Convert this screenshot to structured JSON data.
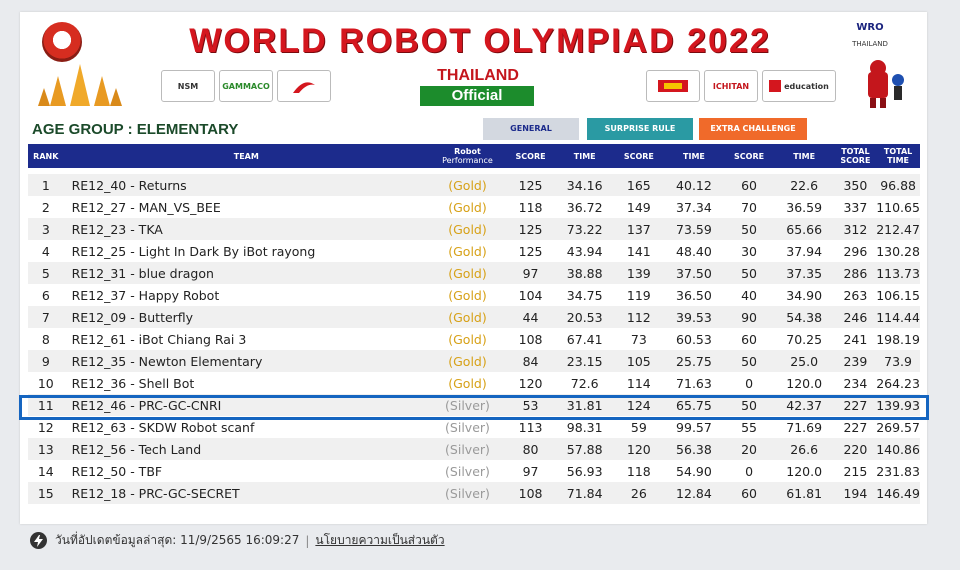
{
  "header": {
    "title": "WORLD ROBOT OLYMPIAD 2022",
    "country": "THAILAND",
    "status": "Official",
    "wro_logo": "WRO",
    "wro_country": "THAILAND",
    "sponsors_left": [
      "NSM",
      "GAMMACO",
      ""
    ],
    "sponsors_right": [
      "",
      "ICHITAN",
      "education"
    ]
  },
  "age_group": "AGE GROUP : ELEMENTARY",
  "tabs": {
    "general": "GENERAL",
    "surprise": "SURPRISE RULE",
    "extra": "EXTRA CHALLENGE"
  },
  "columns": {
    "rank": "RANK",
    "team": "TEAM",
    "perf_top": "Robot",
    "perf_bottom": "Performance",
    "score1": "SCORE",
    "time1": "TIME",
    "score2": "SCORE",
    "time2": "TIME",
    "score3": "SCORE",
    "time3": "TIME",
    "total_score_top": "TOTAL",
    "total_score_bottom": "SCORE",
    "total_time_top": "TOTAL",
    "total_time_bottom": "TIME"
  },
  "rows": [
    {
      "rank": "1",
      "team": "RE12_40 - Returns",
      "perf": "(Gold)",
      "s1": "125",
      "t1": "34.16",
      "s2": "165",
      "t2": "40.12",
      "s3": "60",
      "t3": "22.6",
      "ts": "350",
      "tt": "96.88"
    },
    {
      "rank": "2",
      "team": "RE12_27 - MAN_VS_BEE",
      "perf": "(Gold)",
      "s1": "118",
      "t1": "36.72",
      "s2": "149",
      "t2": "37.34",
      "s3": "70",
      "t3": "36.59",
      "ts": "337",
      "tt": "110.65"
    },
    {
      "rank": "3",
      "team": "RE12_23 - TKA",
      "perf": "(Gold)",
      "s1": "125",
      "t1": "73.22",
      "s2": "137",
      "t2": "73.59",
      "s3": "50",
      "t3": "65.66",
      "ts": "312",
      "tt": "212.47"
    },
    {
      "rank": "4",
      "team": "RE12_25 - Light In Dark By iBot rayong",
      "perf": "(Gold)",
      "s1": "125",
      "t1": "43.94",
      "s2": "141",
      "t2": "48.40",
      "s3": "30",
      "t3": "37.94",
      "ts": "296",
      "tt": "130.28"
    },
    {
      "rank": "5",
      "team": "RE12_31 - blue dragon",
      "perf": "(Gold)",
      "s1": "97",
      "t1": "38.88",
      "s2": "139",
      "t2": "37.50",
      "s3": "50",
      "t3": "37.35",
      "ts": "286",
      "tt": "113.73"
    },
    {
      "rank": "6",
      "team": "RE12_37 - Happy Robot",
      "perf": "(Gold)",
      "s1": "104",
      "t1": "34.75",
      "s2": "119",
      "t2": "36.50",
      "s3": "40",
      "t3": "34.90",
      "ts": "263",
      "tt": "106.15"
    },
    {
      "rank": "7",
      "team": "RE12_09 - Butterfly",
      "perf": "(Gold)",
      "s1": "44",
      "t1": "20.53",
      "s2": "112",
      "t2": "39.53",
      "s3": "90",
      "t3": "54.38",
      "ts": "246",
      "tt": "114.44"
    },
    {
      "rank": "8",
      "team": "RE12_61 - iBot Chiang Rai 3",
      "perf": "(Gold)",
      "s1": "108",
      "t1": "67.41",
      "s2": "73",
      "t2": "60.53",
      "s3": "60",
      "t3": "70.25",
      "ts": "241",
      "tt": "198.19"
    },
    {
      "rank": "9",
      "team": "RE12_35 - Newton Elementary",
      "perf": "(Gold)",
      "s1": "84",
      "t1": "23.15",
      "s2": "105",
      "t2": "25.75",
      "s3": "50",
      "t3": "25.0",
      "ts": "239",
      "tt": "73.9"
    },
    {
      "rank": "10",
      "team": "RE12_36 - Shell Bot",
      "perf": "(Gold)",
      "s1": "120",
      "t1": "72.6",
      "s2": "114",
      "t2": "71.63",
      "s3": "0",
      "t3": "120.0",
      "ts": "234",
      "tt": "264.23"
    },
    {
      "rank": "11",
      "team": "RE12_46 - PRC-GC-CNRI",
      "perf": "(Silver)",
      "s1": "53",
      "t1": "31.81",
      "s2": "124",
      "t2": "65.75",
      "s3": "50",
      "t3": "42.37",
      "ts": "227",
      "tt": "139.93"
    },
    {
      "rank": "12",
      "team": "RE12_63 - SKDW Robot scanf",
      "perf": "(Silver)",
      "s1": "113",
      "t1": "98.31",
      "s2": "59",
      "t2": "99.57",
      "s3": "55",
      "t3": "71.69",
      "ts": "227",
      "tt": "269.57"
    },
    {
      "rank": "13",
      "team": "RE12_56 - Tech Land",
      "perf": "(Silver)",
      "s1": "80",
      "t1": "57.88",
      "s2": "120",
      "t2": "56.38",
      "s3": "20",
      "t3": "26.6",
      "ts": "220",
      "tt": "140.86"
    },
    {
      "rank": "14",
      "team": "RE12_50 - TBF",
      "perf": "(Silver)",
      "s1": "97",
      "t1": "56.93",
      "s2": "118",
      "t2": "54.90",
      "s3": "0",
      "t3": "120.0",
      "ts": "215",
      "tt": "231.83"
    },
    {
      "rank": "15",
      "team": "RE12_18 - PRC-GC-SECRET",
      "perf": "(Silver)",
      "s1": "108",
      "t1": "71.84",
      "s2": "26",
      "t2": "12.84",
      "s3": "60",
      "t3": "61.81",
      "ts": "194",
      "tt": "146.49"
    }
  ],
  "footer": {
    "icon": "bolt-icon",
    "updated": "วันที่อัปเดตข้อมูลล่าสุด: 11/9/2565 16:09:27",
    "separator": "|",
    "policy": "นโยบายความเป็นส่วนตัว"
  },
  "colors": {
    "title": "#d4161e",
    "header_bg": "#1c2b8c",
    "gold": "#d7a117",
    "silver": "#9a9a9a",
    "highlight": "#1565c0",
    "official_bg": "#1c8c2c"
  }
}
